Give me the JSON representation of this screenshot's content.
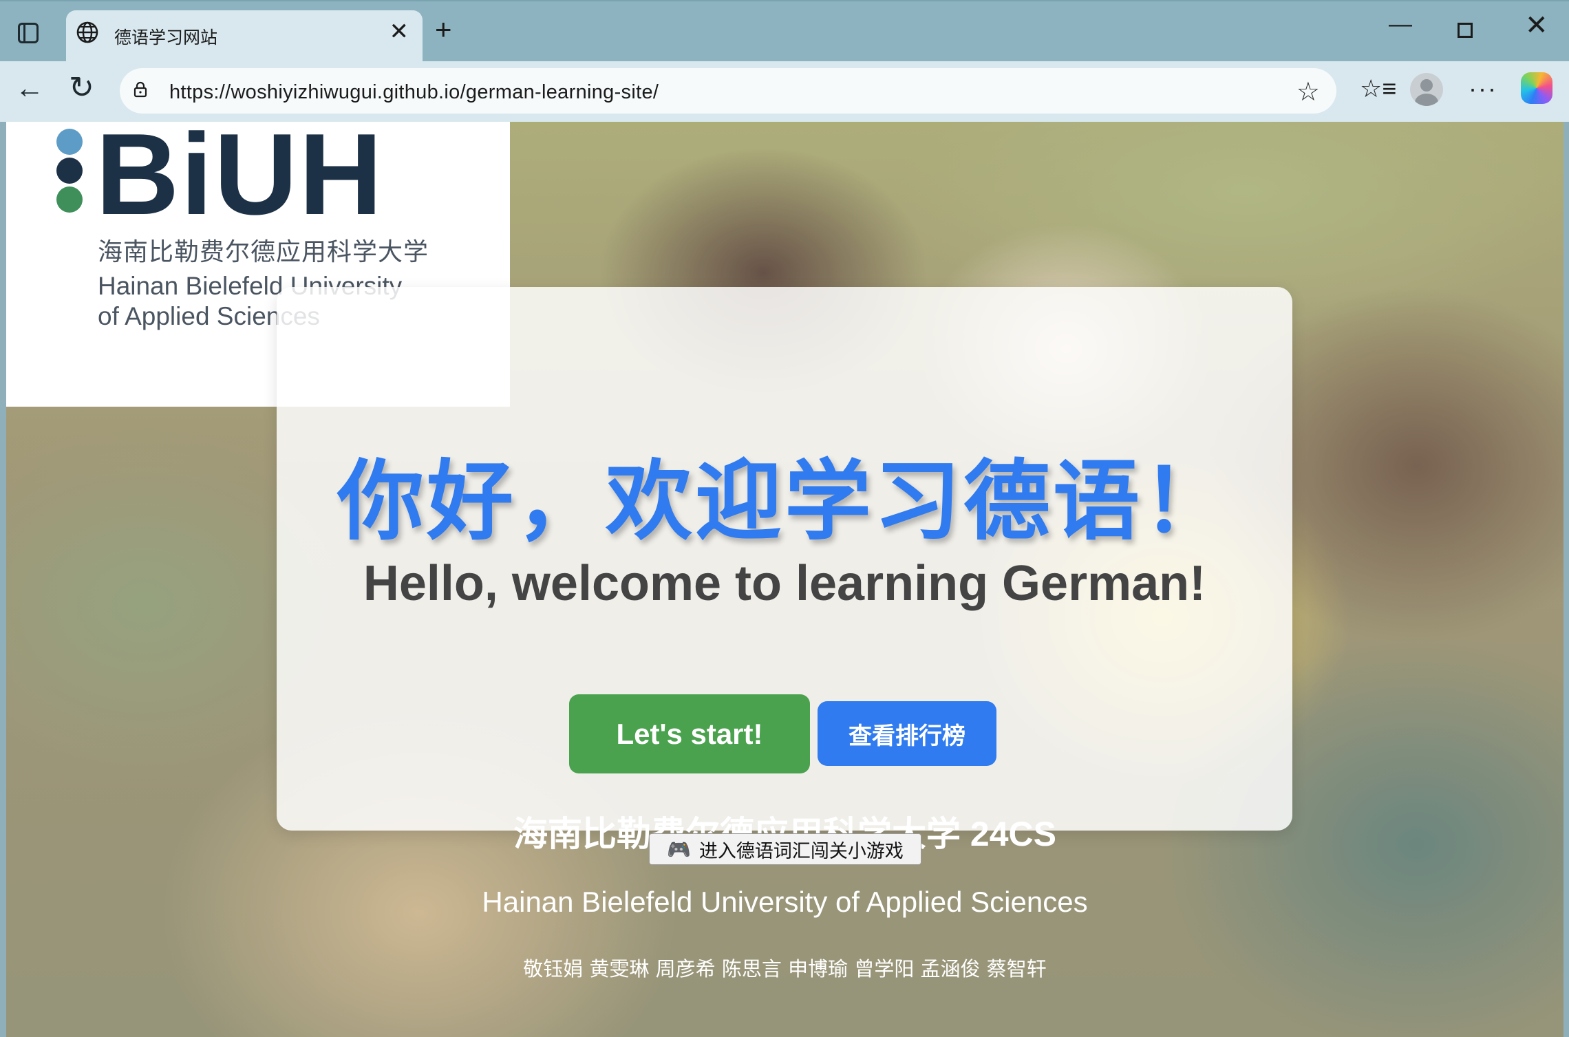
{
  "browser": {
    "tab_title": "德语学习网站",
    "url": "https://woshiyizhiwugui.github.io/german-learning-site/",
    "icons": {
      "sidebar": "sidebar-toggle-icon",
      "globe": "globe-icon",
      "tab_close": "close-icon",
      "new_tab": "plus-icon",
      "minimize": "minimize-icon",
      "maximize": "maximize-icon",
      "window_close": "close-icon",
      "back": "arrow-left-icon",
      "reload": "reload-icon",
      "lock": "lock-icon",
      "favorite": "star-icon",
      "favorites": "favorites-icon",
      "profile": "profile-icon",
      "more": "more-icon",
      "copilot": "copilot-icon"
    }
  },
  "logo": {
    "mark": "BiUH",
    "cn": "海南比勒费尔德应用科学大学",
    "en_line1": "Hainan Bielefeld University",
    "en_line2": "of Applied Sciences"
  },
  "hero": {
    "title_cn": "你好，欢迎学习德语！",
    "title_en": "Hello, welcome to learning German!",
    "start_button": "Let's start!",
    "leaderboard_button": "查看排行榜"
  },
  "footer": {
    "title_cn": "海南比勒费尔德应用科学大学 24CS",
    "game_button": "进入德语词汇闯关小游戏",
    "university_en": "Hainan Bielefeld University of Applied Sciences",
    "names": "敬钰娟 黄雯琳 周彦希 陈思言 申博瑜 曾学阳 孟涵俊 蔡智轩"
  },
  "colors": {
    "primary_blue": "#2f7bef",
    "start_green": "#4aa24e",
    "logo_navy": "#1d3146",
    "chrome": "#8cb3bf"
  }
}
